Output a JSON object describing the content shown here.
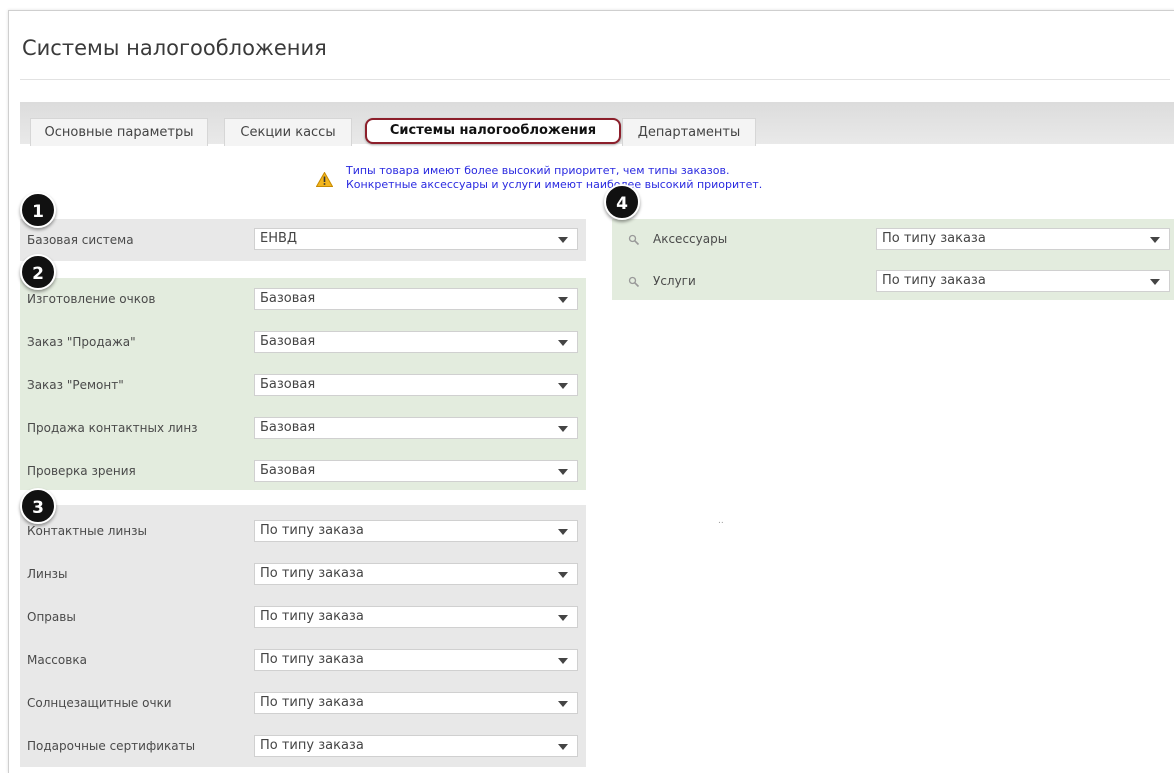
{
  "page": {
    "title": "Системы налогообложения"
  },
  "tabs": [
    {
      "label": "Основные параметры"
    },
    {
      "label": "Секции кассы"
    },
    {
      "label": "Системы налогообложения",
      "active": true
    },
    {
      "label": "Департаменты"
    }
  ],
  "notice": {
    "line1": "Типы товара имеют более высокий приоритет, чем типы заказов.",
    "line2": "Конкретные аксессуары и услуги имеют наиболее высокий приоритет.",
    "icon": "warning-icon",
    "color": "#2a2ae0"
  },
  "badges": [
    "1",
    "2",
    "3",
    "4"
  ],
  "base_system": {
    "label": "Базовая система",
    "value": "ЕНВД"
  },
  "order_types": [
    {
      "label": "Изготовление очков",
      "value": "Базовая"
    },
    {
      "label": "Заказ \"Продажа\"",
      "value": "Базовая"
    },
    {
      "label": "Заказ \"Ремонт\"",
      "value": "Базовая"
    },
    {
      "label": "Продажа контактных линз",
      "value": "Базовая"
    },
    {
      "label": "Проверка зрения",
      "value": "Базовая"
    }
  ],
  "product_types": [
    {
      "label": "Контактные линзы",
      "value": "По типу заказа"
    },
    {
      "label": "Линзы",
      "value": "По типу заказа"
    },
    {
      "label": "Оправы",
      "value": "По типу заказа"
    },
    {
      "label": "Массовка",
      "value": "По типу заказа"
    },
    {
      "label": "Солнцезащитные очки",
      "value": "По типу заказа"
    },
    {
      "label": "Подарочные сертификаты",
      "value": "По типу заказа"
    }
  ],
  "specific": [
    {
      "label": "Аксессуары",
      "value": "По типу заказа",
      "icon": "search-icon"
    },
    {
      "label": "Услуги",
      "value": "По типу заказа",
      "icon": "search-icon"
    }
  ],
  "colors": {
    "accent_tab_border": "#8c1f2b",
    "green_panel": "#e3ecde",
    "gray_panel": "#e8e8e8"
  },
  "misc": {
    "dots": ".."
  }
}
